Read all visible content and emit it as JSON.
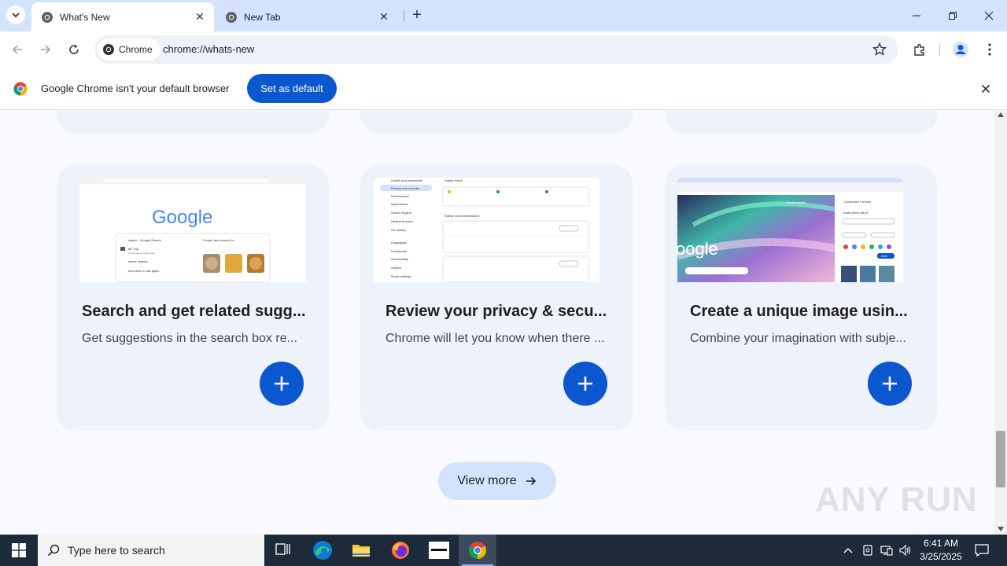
{
  "window": {
    "tabs": [
      {
        "title": "What's New",
        "active": true
      },
      {
        "title": "New Tab",
        "active": false
      }
    ],
    "controls": {
      "minimize_icon": "minimize-icon",
      "restore_icon": "restore-icon",
      "close_icon": "close-icon"
    }
  },
  "toolbar": {
    "chip_label": "Chrome",
    "url": "chrome://whats-new"
  },
  "infobar": {
    "message": "Google Chrome isn't your default browser",
    "button_label": "Set as default"
  },
  "cards": [
    {
      "title": "Search and get related sugg...",
      "description": "Get suggestions in the search box re...",
      "screenshot": {
        "logo": "Google",
        "result_1": "salam – Google Search",
        "result_2": "Mt. Fuji",
        "result_3": "Snow-capped peaks near",
        "result_4": "sauce recipes",
        "result_5": "best time to visit japan",
        "people_also": "People also search for"
      }
    },
    {
      "title": "Review your privacy & secu...",
      "description": "Chrome will let you know when there ...",
      "screenshot": {
        "side_items": [
          "You and Google",
          "Autofill and passwords",
          "Privacy and security",
          "Performance",
          "Appearance",
          "Search engine",
          "Default browser",
          "On startup",
          "Languages",
          "Downloads",
          "Accessibility",
          "System",
          "Reset settings"
        ],
        "heading": "Safety check",
        "recommended": "Safety recommendations"
      }
    },
    {
      "title": "Create a unique image usin...",
      "description": "Combine your imagination with subje...",
      "screenshot": {
        "logo_fragment": "oogle",
        "panel_title": "Customize Chrome",
        "panel_subtitle": "Create theme with AI",
        "nav_1": "Gmail",
        "nav_2": "Images",
        "done_label": "Done"
      }
    }
  ],
  "view_more": "View more",
  "watermark": "ANY RUN",
  "taskbar": {
    "search_placeholder": "Type here to search",
    "time": "6:41 AM",
    "date": "3/25/2025"
  },
  "colors": {
    "accent": "#0b57d0",
    "tabstrip": "#d3e3fd",
    "card_bg": "#eef2fa",
    "taskbar": "#1c2a3a"
  }
}
